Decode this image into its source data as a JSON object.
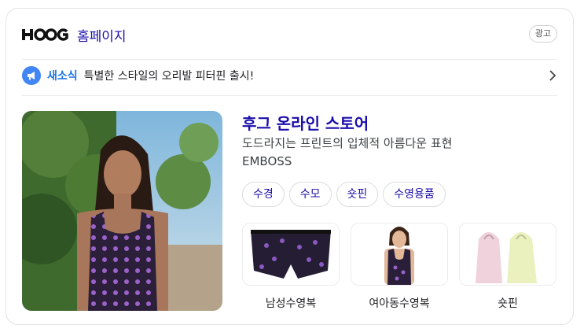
{
  "header": {
    "brand": "HOOG",
    "homepage_label": "홈페이지",
    "ad_badge": "광고"
  },
  "news": {
    "icon": "megaphone-icon",
    "tag": "새소식",
    "text": "특별한 스타일의 오리발 피터핀 출시!"
  },
  "store": {
    "title": "후그 온라인 스토어",
    "description_line1": "도드라지는 프린트의 입체적 아름다운 표현",
    "description_line2": "EMBOSS"
  },
  "chips": [
    {
      "label": "수경"
    },
    {
      "label": "수모"
    },
    {
      "label": "숏핀"
    },
    {
      "label": "수영용품"
    }
  ],
  "products": [
    {
      "label": "남성수영복"
    },
    {
      "label": "여아동수영복"
    },
    {
      "label": "숏핀"
    }
  ],
  "colors": {
    "link": "#1a0dab",
    "accent": "#1a73e8",
    "icon_bg": "#4285f4"
  }
}
